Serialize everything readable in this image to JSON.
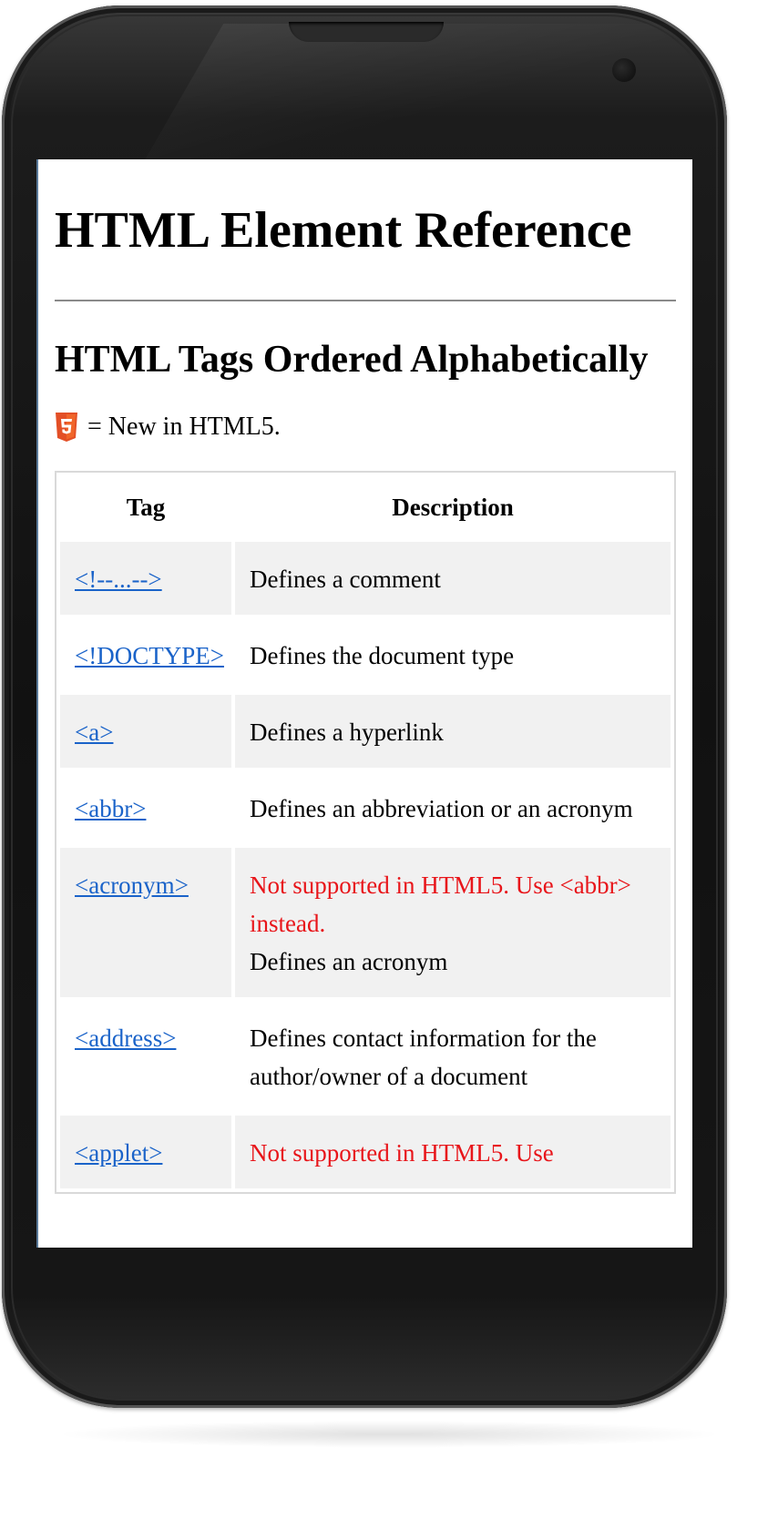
{
  "page": {
    "title": "HTML Element Reference",
    "section_title": "HTML Tags Ordered Alphabetically",
    "legend_text": "= New in HTML5.",
    "html5_icon_color": "#e34f26"
  },
  "table": {
    "headers": [
      "Tag",
      "Description"
    ],
    "rows": [
      {
        "tag": "<!--...-->",
        "note": "",
        "desc": "Defines a comment"
      },
      {
        "tag": "<!DOCTYPE>",
        "note": "",
        "desc": "Defines the document type"
      },
      {
        "tag": "<a>",
        "note": "",
        "desc": "Defines a hyperlink"
      },
      {
        "tag": "<abbr>",
        "note": "",
        "desc": "Defines an abbreviation or an acronym"
      },
      {
        "tag": "<acronym>",
        "note": "Not supported in HTML5. Use <abbr> instead.",
        "desc": "Defines an acronym"
      },
      {
        "tag": "<address>",
        "note": "",
        "desc": "Defines contact information for the author/owner of a document"
      },
      {
        "tag": "<applet>",
        "note": "Not supported in HTML5. Use",
        "desc": ""
      }
    ]
  },
  "colors": {
    "link": "#1a63c9",
    "deprecated_text": "#e8151a",
    "shaded_row": "#f1f1f1"
  }
}
